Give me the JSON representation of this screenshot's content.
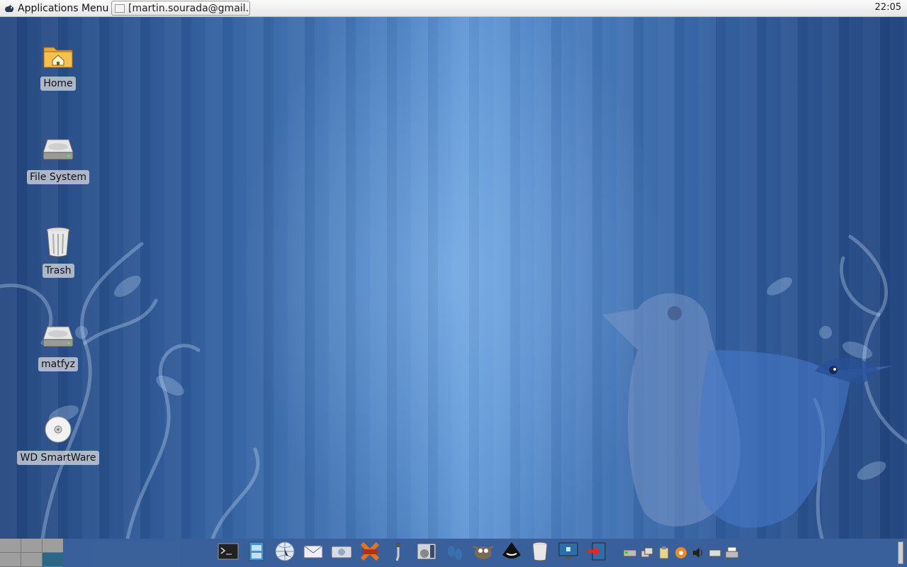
{
  "top_panel": {
    "menu_label": "Applications Menu",
    "task_title": "[martin.sourada@gmail...",
    "clock": "22:05"
  },
  "desktop_icons": [
    {
      "label": "Home",
      "icon": "home-folder-icon"
    },
    {
      "label": "File System",
      "icon": "hard-drive-icon"
    },
    {
      "label": "Trash",
      "icon": "trash-icon"
    },
    {
      "label": "matfyz",
      "icon": "hard-drive-icon"
    },
    {
      "label": "WD SmartWare",
      "icon": "optical-disc-icon"
    }
  ],
  "workspaces": {
    "count": 6,
    "active_index": 5
  },
  "launchers": [
    "terminal-icon",
    "file-cabinet-icon",
    "web-browser-icon",
    "mail-icon",
    "network-scanner-icon",
    "cpot-icon",
    "eyedropper-icon",
    "media-player-icon",
    "footprints-icon",
    "gimp-icon",
    "inkscape-icon",
    "trash-icon",
    "remote-desktop-icon",
    "logout-icon"
  ],
  "tray": [
    "network-icon",
    "windows-icon",
    "clipboard-icon",
    "update-icon",
    "volume-icon",
    "removable-drive-icon",
    "printer-icon"
  ],
  "colors": {
    "active_workspace": "#2c6886",
    "wallpaper_blue": "#2f5a98"
  }
}
